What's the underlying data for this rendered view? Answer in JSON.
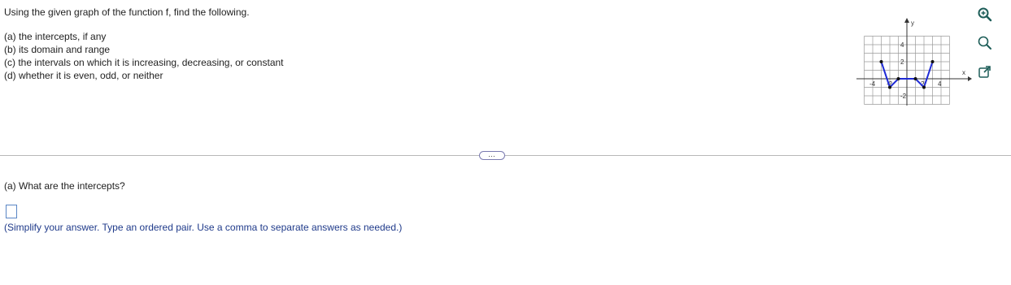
{
  "problem": {
    "intro": "Using the given graph of the function f, find the following.",
    "parts": [
      "(a) the intercepts, if any",
      "(b) its domain and range",
      "(c) the intervals on which it is increasing, decreasing, or constant",
      "(d) whether it is even, odd, or neither"
    ]
  },
  "graph": {
    "axis_x_label": "x",
    "axis_y_label": "y",
    "x_ticks": [
      "-4",
      "-2",
      "2",
      "4"
    ],
    "y_ticks": [
      "4",
      "2",
      "-2"
    ],
    "points": [
      {
        "x": -3,
        "y": 2
      },
      {
        "x": -2,
        "y": -1
      },
      {
        "x": -1,
        "y": 0
      },
      {
        "x": 1,
        "y": 0
      },
      {
        "x": 2,
        "y": -1
      },
      {
        "x": 3,
        "y": 2
      }
    ],
    "line_color": "#1f2bd6"
  },
  "toolbar": {
    "zoom_in_icon": "zoom-in-icon",
    "zoom_out_icon": "zoom-out-icon",
    "popout_icon": "popout-icon"
  },
  "more_button_label": "…",
  "question": {
    "text": "(a) What are the intercepts?",
    "hint": "(Simplify your answer. Type an ordered pair. Use a comma to separate answers as needed.)"
  }
}
